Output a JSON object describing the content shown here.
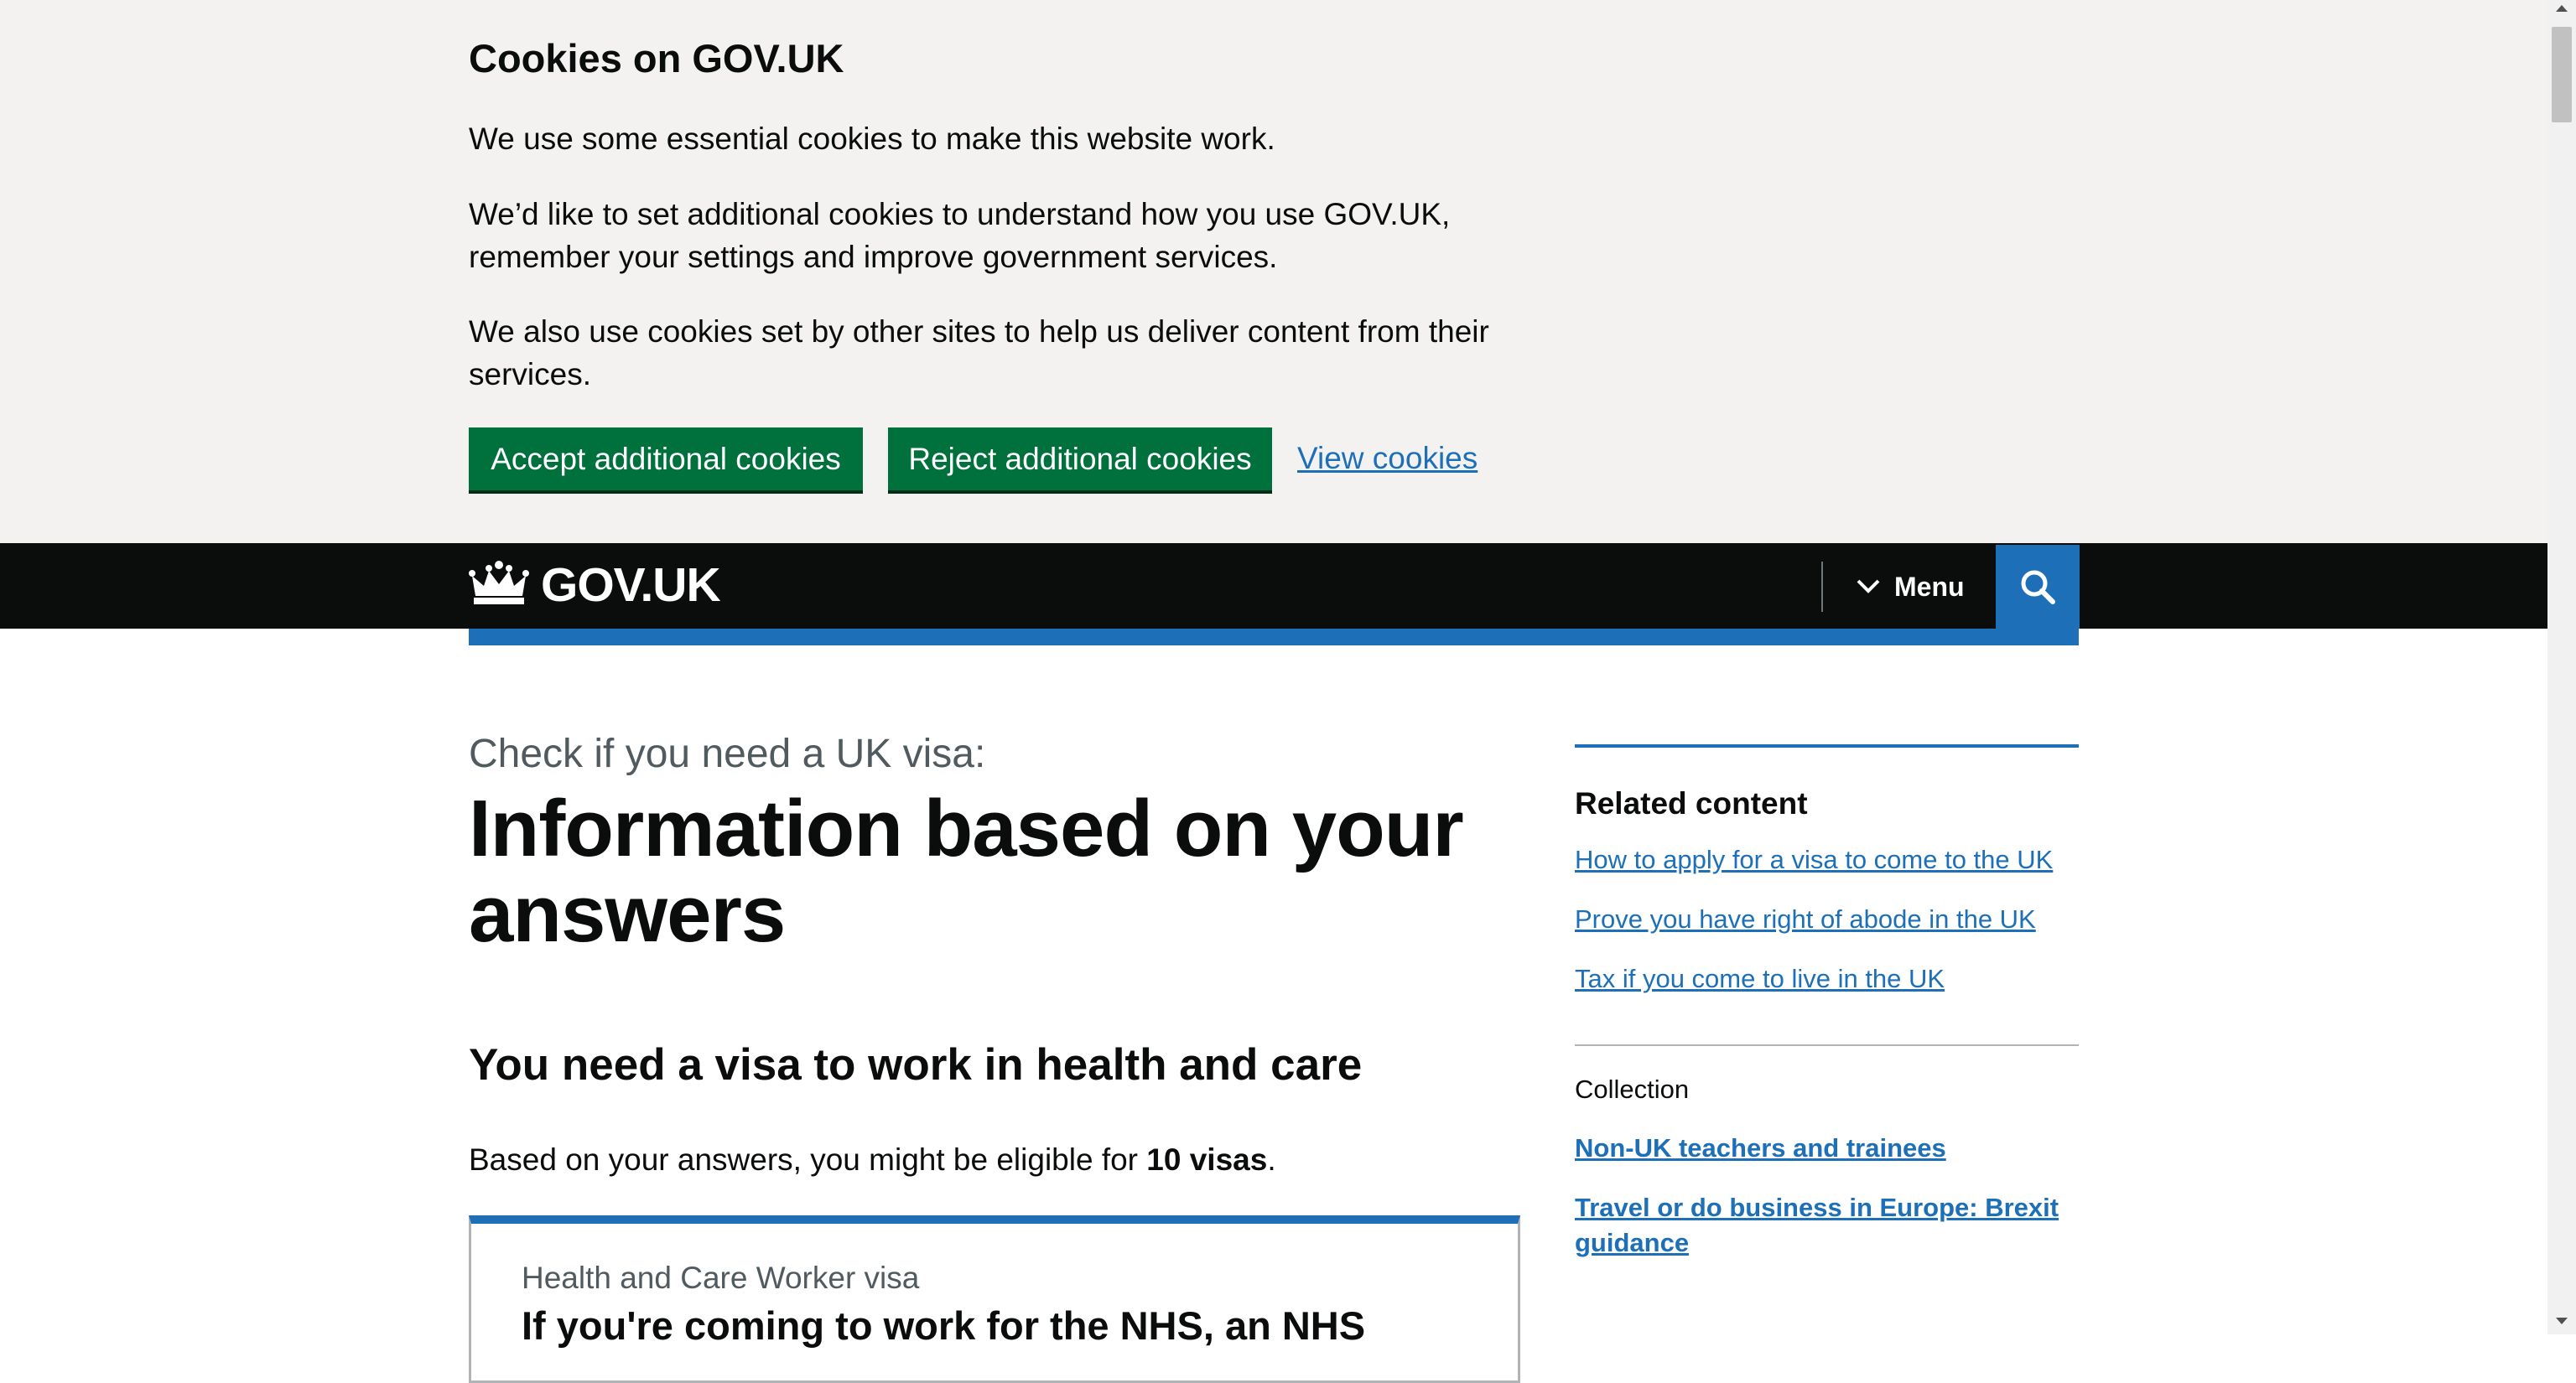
{
  "cookie_banner": {
    "title": "Cookies on GOV.UK",
    "paragraph_1": "We use some essential cookies to make this website work.",
    "paragraph_2": "We’d like to set additional cookies to understand how you use GOV.UK, remember your settings and improve government services.",
    "paragraph_3": "We also use cookies set by other sites to help us deliver content from their services.",
    "accept_label": "Accept additional cookies",
    "reject_label": "Reject additional cookies",
    "view_label": "View cookies",
    "button_color": "#00703c",
    "link_color": "#1d70b8"
  },
  "header": {
    "logo_text": "GOV.UK",
    "logo_icon": "crown-icon",
    "menu_label": "Menu",
    "menu_icon": "chevron-down-icon",
    "search_icon": "search-icon",
    "background_color": "#0b0c0c",
    "accent_color": "#1d70b8"
  },
  "main": {
    "caption": "Check if you need a UK visa:",
    "title": "Information based on your answers",
    "result_heading": "You need a visa to work in health and care",
    "eligible_prefix": "Based on your answers, you might be eligible for ",
    "eligible_count": "10 visas",
    "eligible_suffix": ".",
    "visa_card": {
      "caption": "Health and Care Worker visa",
      "heading": "If you're coming to work for the NHS, an NHS"
    }
  },
  "sidebar": {
    "related_title": "Related content",
    "related_links": [
      "How to apply for a visa to come to the UK",
      "Prove you have right of abode in the UK",
      "Tax if you come to live in the UK"
    ],
    "collection_label": "Collection",
    "collection_links": [
      "Non-UK teachers and trainees",
      "Travel or do business in Europe: Brexit guidance"
    ]
  }
}
